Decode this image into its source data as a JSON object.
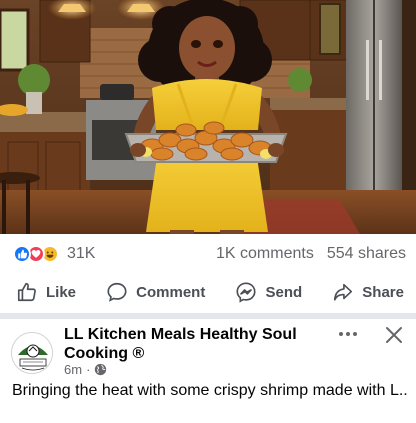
{
  "stats": {
    "reaction_icons": [
      "like-icon",
      "love-icon",
      "haha-icon"
    ],
    "reaction_count": "31K",
    "comments": "1K comments",
    "shares": "554 shares"
  },
  "actions": {
    "like": "Like",
    "comment": "Comment",
    "send": "Send",
    "share": "Share"
  },
  "post": {
    "page_name": "LL Kitchen Meals Healthy Soul Cooking ®",
    "time": "6m",
    "separator": "·",
    "audience_icon": "globe-icon",
    "caption": "Bringing the heat with some crispy shrimp made with L..."
  },
  "colors": {
    "like_blue": "#1877f2",
    "love_red": "#f33e58",
    "haha_yellow": "#f7b928",
    "secondary_text": "#65676b",
    "divider": "#e4e6eb"
  }
}
